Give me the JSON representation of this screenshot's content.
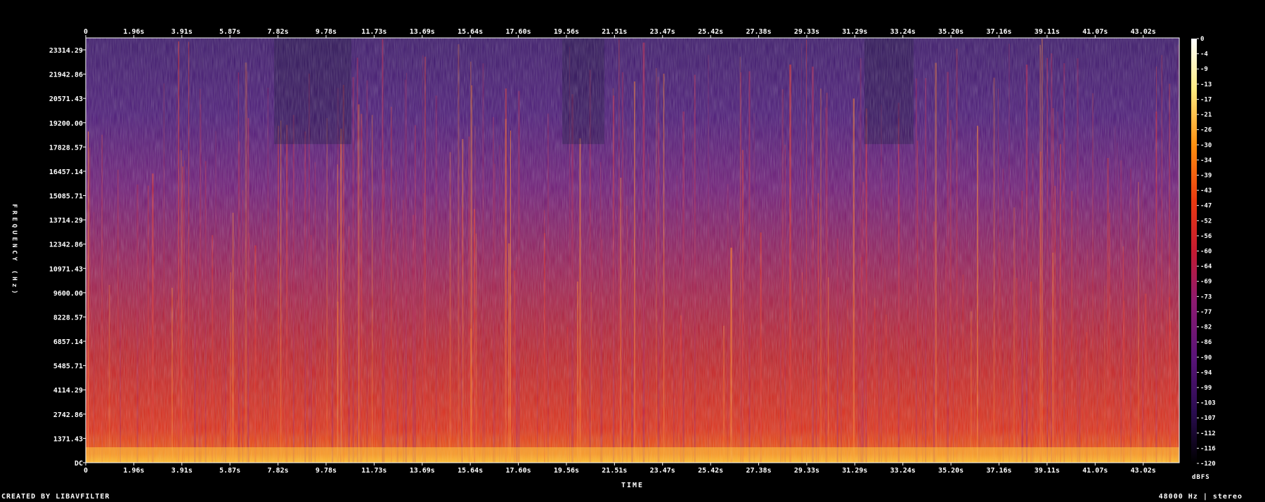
{
  "chart_data": {
    "type": "heatmap",
    "title": "",
    "xlabel": "TIME",
    "ylabel": "FREQUENCY (Hz)",
    "x_ticks": [
      "0",
      "1.96s",
      "3.91s",
      "5.87s",
      "7.82s",
      "9.78s",
      "11.73s",
      "13.69s",
      "15.64s",
      "17.60s",
      "19.56s",
      "21.51s",
      "23.47s",
      "25.42s",
      "27.38s",
      "29.33s",
      "31.29s",
      "33.24s",
      "35.20s",
      "37.16s",
      "39.11s",
      "41.07s",
      "43.02s"
    ],
    "y_ticks": [
      "23314.29",
      "21942.86",
      "20571.43",
      "19200.00",
      "17828.57",
      "16457.14",
      "15085.71",
      "13714.29",
      "12342.86",
      "10971.43",
      "9600.00",
      "8228.57",
      "6857.14",
      "5485.71",
      "4114.29",
      "2742.86",
      "1371.43",
      "DC"
    ],
    "xlim": [
      0,
      44.5
    ],
    "ylim": [
      0,
      24000
    ],
    "colorbar": {
      "unit": "dBFS",
      "ticks": [
        "0",
        "-4",
        "-9",
        "-13",
        "-17",
        "-21",
        "-26",
        "-30",
        "-34",
        "-39",
        "-43",
        "-47",
        "-52",
        "-56",
        "-60",
        "-64",
        "-69",
        "-73",
        "-77",
        "-82",
        "-86",
        "-90",
        "-94",
        "-99",
        "-103",
        "-107",
        "-112",
        "-116",
        "-120"
      ],
      "range": [
        -120,
        0
      ],
      "colormap": [
        "#000000",
        "#1a0a3a",
        "#3a1470",
        "#5a1a80",
        "#8a1e78",
        "#b8205a",
        "#d9281e",
        "#f04a0a",
        "#ff8a10",
        "#ffd040",
        "#ffffc0",
        "#ffffff"
      ]
    }
  },
  "footer": {
    "created_by": "CREATED BY LIBAVFILTER",
    "format": "48000 Hz | stereo"
  }
}
